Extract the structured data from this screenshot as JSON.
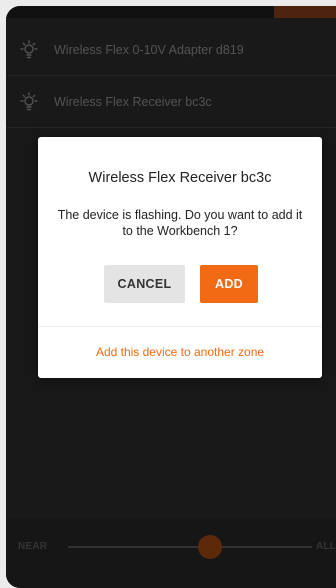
{
  "devices": [
    {
      "name": "Wireless Flex 0-10V Adapter d819",
      "icon": "bulb-icon"
    },
    {
      "name": "Wireless Flex Receiver bc3c",
      "icon": "bulb-icon"
    }
  ],
  "dialog": {
    "title": "Wireless Flex Receiver bc3c",
    "message": "The device is flashing. Do you want to add it to the Workbench 1?",
    "cancel_label": "CANCEL",
    "add_label": "ADD",
    "alt_zone_link": "Add this device to another zone"
  },
  "slider": {
    "left_label": "NEAR",
    "right_label": "ALL",
    "value": 0.58
  },
  "colors": {
    "accent": "#f26a13",
    "background": "#1d1d1d",
    "dialog": "#ffffff",
    "cancel_bg": "#e4e4e4"
  }
}
